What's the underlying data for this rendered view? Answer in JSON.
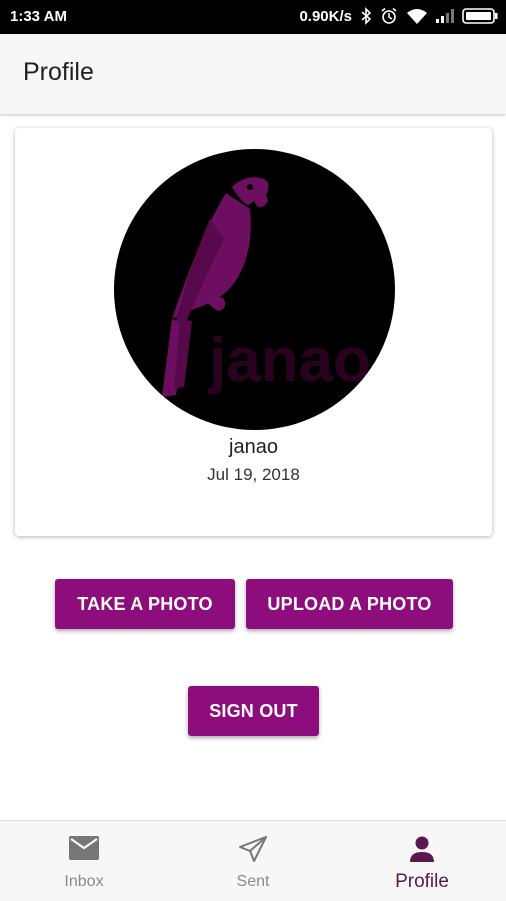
{
  "status_bar": {
    "time": "1:33 AM",
    "network_speed": "0.90K/s",
    "icons": [
      "bluetooth-icon",
      "alarm-icon",
      "wifi-icon",
      "signal-icon",
      "battery-icon"
    ]
  },
  "app_bar": {
    "title": "Profile"
  },
  "profile": {
    "avatar_logo_text": "janao",
    "username": "janao",
    "join_date": "Jul 19, 2018"
  },
  "actions": {
    "take_photo": "TAKE A PHOTO",
    "upload_photo": "UPLOAD A PHOTO",
    "sign_out": "SIGN OUT"
  },
  "bottom_nav": {
    "items": [
      {
        "label": "Inbox",
        "icon": "mail-icon",
        "active": false
      },
      {
        "label": "Sent",
        "icon": "send-icon",
        "active": false
      },
      {
        "label": "Profile",
        "icon": "person-icon",
        "active": true
      }
    ]
  },
  "colors": {
    "accent": "#8e0d7d",
    "active_nav": "#5b1750",
    "inactive_nav": "#8a8a8a",
    "status_bar": "#000000"
  }
}
